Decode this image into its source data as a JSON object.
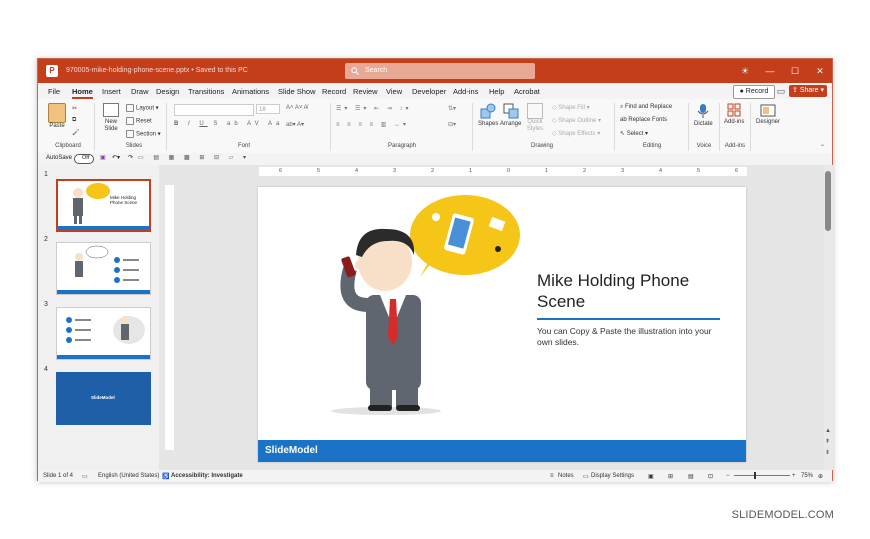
{
  "window": {
    "doc_title": "970005-mike-holding-phone-scene.pptx • Saved to this PC",
    "search_placeholder": "Search",
    "min": "—",
    "max": "☐",
    "close": "✕"
  },
  "tabs": [
    "File",
    "Home",
    "Insert",
    "Draw",
    "Design",
    "Transitions",
    "Animations",
    "Slide Show",
    "Record",
    "Review",
    "View",
    "Developer",
    "Add-ins",
    "Help",
    "Acrobat"
  ],
  "active_tab": "Home",
  "record_label": "Record",
  "share_label": "Share",
  "ribbon": {
    "clipboard": {
      "paste": "Paste",
      "label": "Clipboard"
    },
    "slides": {
      "new_slide": "New Slide",
      "layout": "Layout",
      "reset": "Reset",
      "section": "Section",
      "label": "Slides"
    },
    "font": {
      "size": "18",
      "label": "Font"
    },
    "paragraph": {
      "label": "Paragraph"
    },
    "drawing": {
      "shapes": "Shapes",
      "arrange": "Arrange",
      "quick_styles": "Quick Styles",
      "shape_fill": "Shape Fill",
      "shape_outline": "Shape Outline",
      "shape_effects": "Shape Effects",
      "label": "Drawing"
    },
    "editing": {
      "find": "Find and Replace",
      "replace_fonts": "Replace Fonts",
      "select": "Select",
      "label": "Editing"
    },
    "voice": {
      "dictate": "Dictate",
      "label": "Voice"
    },
    "addins": {
      "addins": "Add-ins",
      "label": "Add-ins"
    },
    "designer": {
      "designer": "Designer"
    }
  },
  "qat": {
    "autosave": "AutoSave",
    "off": "Off"
  },
  "thumbnails": [
    {
      "num": "1",
      "title": "Mike Holding Phone Scene"
    },
    {
      "num": "2"
    },
    {
      "num": "3"
    },
    {
      "num": "4",
      "title": "SlideModel"
    }
  ],
  "ruler": [
    "6",
    "5",
    "4",
    "3",
    "2",
    "1",
    "0",
    "1",
    "2",
    "3",
    "4",
    "5",
    "6"
  ],
  "slide": {
    "title": "Mike Holding Phone Scene",
    "body": "You can Copy & Paste the illustration into your own slides.",
    "logo": "SlideModel"
  },
  "status": {
    "slide_of": "Slide 1 of 4",
    "language": "English (United States)",
    "accessibility": "Accessibility: Investigate",
    "notes": "Notes",
    "display_settings": "Display Settings",
    "zoom": "75%"
  },
  "credit": "SLIDEMODEL.COM",
  "colors": {
    "accent": "#c43e1c",
    "slide_blue": "#1a73c7",
    "bubble_yellow": "#f5c518"
  }
}
